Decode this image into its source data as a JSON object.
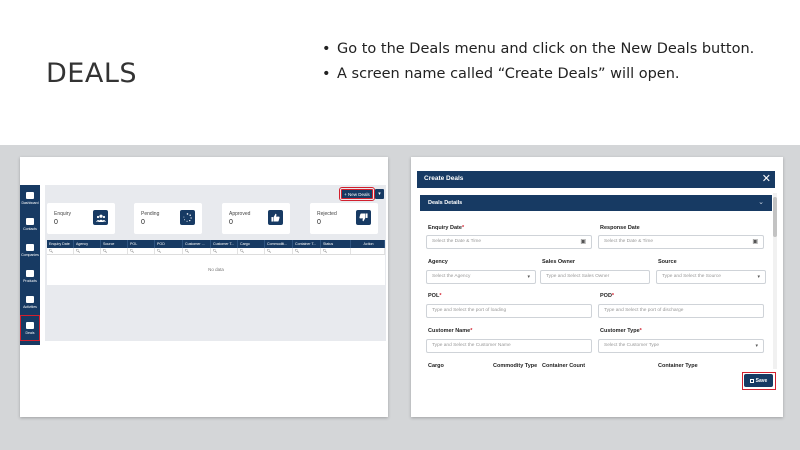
{
  "slide": {
    "title": "DEALS",
    "bullets": [
      "Go to the Deals menu and click on the New Deals button.",
      "A screen name called “Create Deals” will open."
    ]
  },
  "list_screen": {
    "nav": [
      {
        "label": "Dashboard",
        "icon": "dashboard-icon",
        "active": false
      },
      {
        "label": "Contacts",
        "icon": "contacts-icon",
        "active": false
      },
      {
        "label": "Companies",
        "icon": "companies-icon",
        "active": false
      },
      {
        "label": "Products",
        "icon": "products-icon",
        "active": false
      },
      {
        "label": "Activities",
        "icon": "activities-icon",
        "active": false
      },
      {
        "label": "Deals",
        "icon": "deals-icon",
        "active": true
      }
    ],
    "new_deal_button": "+ New Deals",
    "new_deal_caret": "▾",
    "stats": [
      {
        "label": "Enquiry",
        "count": "0",
        "icon": "users-icon"
      },
      {
        "label": "Pending",
        "count": "0",
        "icon": "spinner-icon"
      },
      {
        "label": "Approved",
        "count": "0",
        "icon": "thumbs-up-icon"
      },
      {
        "label": "Rejected",
        "count": "0",
        "icon": "thumbs-down-icon"
      }
    ],
    "columns": [
      "Enquiry Date",
      "Agency",
      "Source",
      "POL",
      "POD",
      "Customer ...",
      "Customer T...",
      "Cargo",
      "Commoditi...",
      "Container T...",
      "Status",
      "Action"
    ],
    "empty_text": "No data"
  },
  "create_screen": {
    "title": "Create Deals",
    "close": "✕",
    "section_title": "Deals Details",
    "section_chevron": "⌄",
    "fields": {
      "enquiry_date": {
        "label": "Enquiry Date",
        "placeholder": "Select the Date & Time"
      },
      "response_date": {
        "label": "Response Date",
        "placeholder": "Select the Date & Time"
      },
      "agency": {
        "label": "Agency",
        "placeholder": "Select the Agency"
      },
      "sales_owner": {
        "label": "Sales Owner",
        "placeholder": "Type and Select Sales Owner"
      },
      "source": {
        "label": "Source",
        "placeholder": "Type and Select the Source"
      },
      "pol": {
        "label": "POL",
        "placeholder": "Type and Select the port of loading"
      },
      "pod": {
        "label": "POD",
        "placeholder": "Type and Select the port of discharge"
      },
      "customer_name": {
        "label": "Customer Name",
        "placeholder": "Type and Select the Customer Name"
      },
      "customer_type": {
        "label": "Customer Type",
        "placeholder": "Select the Customer Type"
      },
      "cargo": {
        "label": "Cargo"
      },
      "commodity_type": {
        "label": "Commodity Type"
      },
      "container_count": {
        "label": "Container Count"
      },
      "container_type": {
        "label": "Container Type"
      }
    },
    "required_mark": "*",
    "save_label": "Save",
    "highlight_color": "#d2202e",
    "brand_color": "#173a63"
  }
}
